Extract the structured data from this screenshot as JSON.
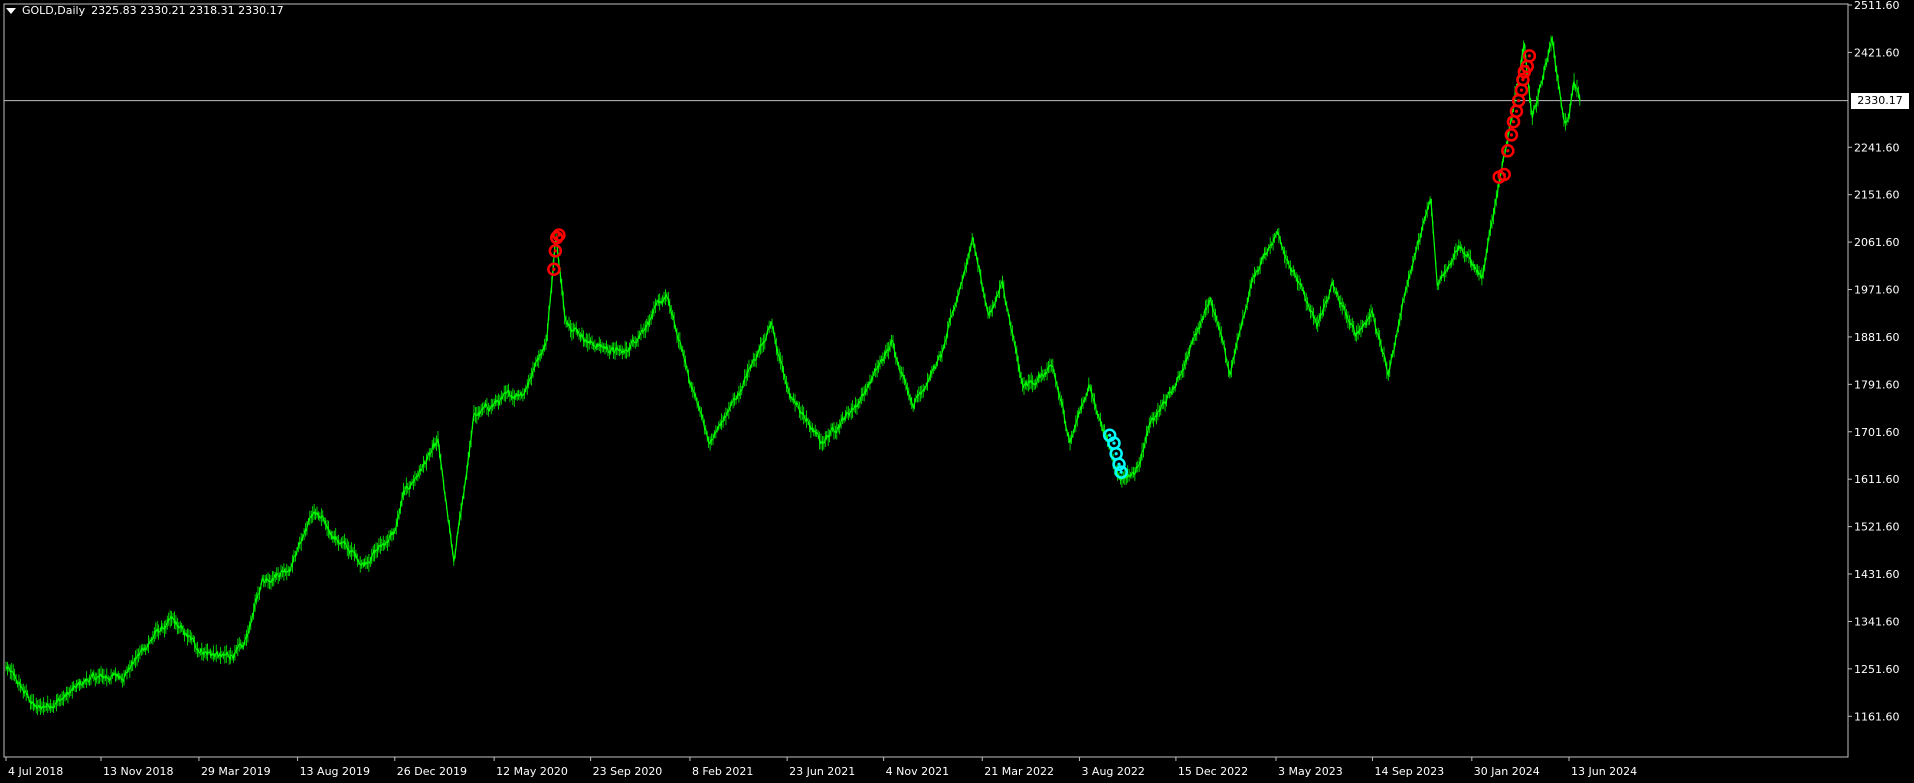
{
  "header": {
    "symbol_period": "GOLD,Daily",
    "ohlc": "2325.83 2330.21 2318.31 2330.17"
  },
  "current_price": {
    "label": "2330.17",
    "value": 2330.17
  },
  "colors": {
    "background": "#000000",
    "frame": "#c0c0c0",
    "bars": "#00ff00",
    "sell_marker": "#ff0000",
    "buy_marker": "#00ffff",
    "text": "#ffffff",
    "price_line": "#c0c0c0"
  },
  "chart_data": {
    "type": "line",
    "subtype": "daily price chart (bar line)",
    "ylim": [
      1116.6,
      2511.6
    ],
    "yticks": [
      "2511.60",
      "2421.60",
      "2241.60",
      "2151.60",
      "2061.60",
      "1971.60",
      "1881.60",
      "1791.60",
      "1701.60",
      "1611.60",
      "1521.60",
      "1431.60",
      "1341.60",
      "1251.60",
      "1161.60"
    ],
    "xticks": [
      "4 Jul 2018",
      "13 Nov 2018",
      "29 Mar 2019",
      "13 Aug 2019",
      "26 Dec 2019",
      "12 May 2020",
      "23 Sep 2020",
      "8 Feb 2021",
      "23 Jun 2021",
      "4 Nov 2021",
      "21 Mar 2022",
      "3 Aug 2022",
      "15 Dec 2022",
      "3 May 2023",
      "14 Sep 2023",
      "30 Jan 2024",
      "13 Jun 2024"
    ],
    "series": [
      {
        "values": [
          [
            "2018-07-04",
            1255
          ],
          [
            "2018-08-16",
            1175
          ],
          [
            "2018-09-20",
            1195
          ],
          [
            "2018-10-26",
            1232
          ],
          [
            "2018-12-14",
            1240
          ],
          [
            "2019-01-29",
            1320
          ],
          [
            "2019-02-20",
            1342
          ],
          [
            "2019-03-29",
            1290
          ],
          [
            "2019-05-02",
            1272
          ],
          [
            "2019-05-30",
            1290
          ],
          [
            "2019-06-25",
            1420
          ],
          [
            "2019-08-02",
            1445
          ],
          [
            "2019-09-04",
            1550
          ],
          [
            "2019-10-04",
            1502
          ],
          [
            "2019-11-12",
            1452
          ],
          [
            "2019-12-26",
            1510
          ],
          [
            "2020-01-07",
            1580
          ],
          [
            "2020-02-24",
            1680
          ],
          [
            "2020-03-17",
            1450
          ],
          [
            "2020-04-14",
            1730
          ],
          [
            "2020-05-18",
            1760
          ],
          [
            "2020-06-23",
            1780
          ],
          [
            "2020-07-24",
            1880
          ],
          [
            "2020-08-06",
            2075
          ],
          [
            "2020-08-18",
            1920
          ],
          [
            "2020-09-23",
            1870
          ],
          [
            "2020-11-09",
            1850
          ],
          [
            "2021-01-06",
            1960
          ],
          [
            "2021-02-08",
            1800
          ],
          [
            "2021-03-08",
            1680
          ],
          [
            "2021-04-19",
            1780
          ],
          [
            "2021-06-01",
            1910
          ],
          [
            "2021-06-23",
            1780
          ],
          [
            "2021-08-09",
            1680
          ],
          [
            "2021-10-01",
            1760
          ],
          [
            "2021-11-16",
            1870
          ],
          [
            "2021-12-15",
            1755
          ],
          [
            "2022-01-25",
            1850
          ],
          [
            "2022-03-08",
            2070
          ],
          [
            "2022-03-30",
            1920
          ],
          [
            "2022-04-18",
            1980
          ],
          [
            "2022-05-16",
            1785
          ],
          [
            "2022-06-27",
            1820
          ],
          [
            "2022-07-21",
            1685
          ],
          [
            "2022-08-16",
            1790
          ],
          [
            "2022-09-28",
            1615
          ],
          [
            "2022-10-20",
            1625
          ],
          [
            "2022-11-08",
            1710
          ],
          [
            "2022-12-15",
            1790
          ],
          [
            "2023-02-01",
            1960
          ],
          [
            "2023-02-28",
            1810
          ],
          [
            "2023-03-30",
            1985
          ],
          [
            "2023-05-04",
            2082
          ],
          [
            "2023-06-29",
            1900
          ],
          [
            "2023-07-20",
            1980
          ],
          [
            "2023-08-21",
            1885
          ],
          [
            "2023-09-14",
            1930
          ],
          [
            "2023-10-06",
            1810
          ],
          [
            "2023-11-01",
            1985
          ],
          [
            "2023-12-04",
            2140
          ],
          [
            "2023-12-13",
            1980
          ],
          [
            "2024-01-12",
            2060
          ],
          [
            "2024-02-14",
            1990
          ],
          [
            "2024-03-08",
            2180
          ],
          [
            "2024-04-12",
            2430
          ],
          [
            "2024-04-23",
            2290
          ],
          [
            "2024-05-20",
            2450
          ],
          [
            "2024-06-07",
            2285
          ],
          [
            "2024-06-13",
            2305
          ],
          [
            "2024-06-20",
            2365
          ],
          [
            "2024-06-28",
            2330
          ]
        ]
      }
    ],
    "annotations": [
      {
        "type": "sell-arrow",
        "date": "2020-08-03",
        "price": 2010
      },
      {
        "type": "sell-arrow",
        "date": "2020-08-05",
        "price": 2045
      },
      {
        "type": "sell-arrow",
        "date": "2020-08-07",
        "price": 2070
      },
      {
        "type": "sell-arrow",
        "date": "2020-08-10",
        "price": 2075
      },
      {
        "type": "buy-arrow",
        "date": "2022-09-14",
        "price": 1695
      },
      {
        "type": "buy-arrow",
        "date": "2022-09-20",
        "price": 1680
      },
      {
        "type": "buy-arrow",
        "date": "2022-09-23",
        "price": 1660
      },
      {
        "type": "buy-arrow",
        "date": "2022-09-27",
        "price": 1640
      },
      {
        "type": "buy-arrow",
        "date": "2022-09-30",
        "price": 1625
      },
      {
        "type": "sell-arrow",
        "date": "2024-03-08",
        "price": 2185
      },
      {
        "type": "sell-arrow",
        "date": "2024-03-15",
        "price": 2190
      },
      {
        "type": "sell-arrow",
        "date": "2024-03-20",
        "price": 2235
      },
      {
        "type": "sell-arrow",
        "date": "2024-03-25",
        "price": 2265
      },
      {
        "type": "sell-arrow",
        "date": "2024-03-28",
        "price": 2290
      },
      {
        "type": "sell-arrow",
        "date": "2024-04-01",
        "price": 2310
      },
      {
        "type": "sell-arrow",
        "date": "2024-04-04",
        "price": 2330
      },
      {
        "type": "sell-arrow",
        "date": "2024-04-08",
        "price": 2350
      },
      {
        "type": "sell-arrow",
        "date": "2024-04-10",
        "price": 2370
      },
      {
        "type": "sell-arrow",
        "date": "2024-04-12",
        "price": 2385
      },
      {
        "type": "sell-arrow",
        "date": "2024-04-16",
        "price": 2395
      },
      {
        "type": "sell-arrow",
        "date": "2024-04-19",
        "price": 2415
      }
    ],
    "xlabel": "",
    "ylabel": "",
    "grid": false,
    "legend": "none"
  }
}
